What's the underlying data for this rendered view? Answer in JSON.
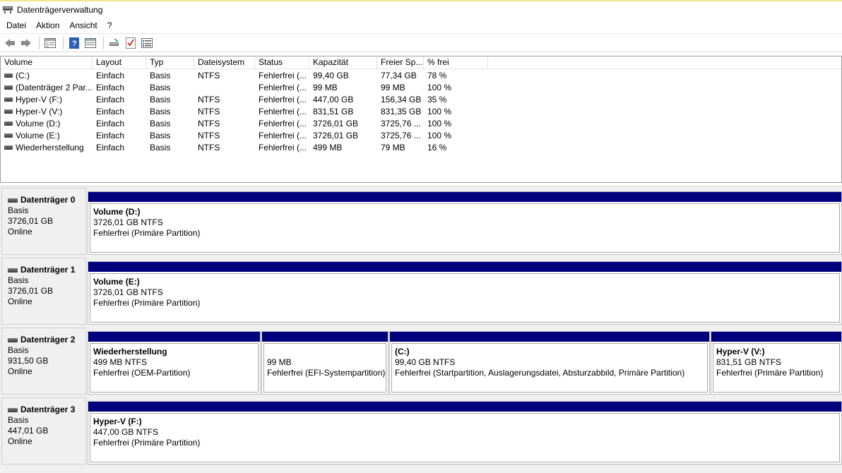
{
  "window": {
    "title": "Datenträgerverwaltung"
  },
  "menu": [
    "Datei",
    "Aktion",
    "Ansicht",
    "?"
  ],
  "toolbar": {
    "icons": [
      "back-icon",
      "forward-icon",
      "console-tree-icon",
      "help-icon",
      "properties-icon",
      "connect-disk-icon",
      "check-icon",
      "list-view-icon"
    ]
  },
  "volume_list": {
    "columns": [
      "Volume",
      "Layout",
      "Typ",
      "Dateisystem",
      "Status",
      "Kapazität",
      "Freier Sp...",
      "% frei"
    ],
    "rows": [
      [
        "(C:)",
        "Einfach",
        "Basis",
        "NTFS",
        "Fehlerfrei (...",
        "99,40 GB",
        "77,34 GB",
        "78 %"
      ],
      [
        "(Datenträger 2 Par...",
        "Einfach",
        "Basis",
        "",
        "Fehlerfrei (...",
        "99 MB",
        "99 MB",
        "100 %"
      ],
      [
        "Hyper-V (F:)",
        "Einfach",
        "Basis",
        "NTFS",
        "Fehlerfrei (...",
        "447,00 GB",
        "156,34 GB",
        "35 %"
      ],
      [
        "Hyper-V (V:)",
        "Einfach",
        "Basis",
        "NTFS",
        "Fehlerfrei (...",
        "831,51 GB",
        "831,35 GB",
        "100 %"
      ],
      [
        "Volume (D:)",
        "Einfach",
        "Basis",
        "NTFS",
        "Fehlerfrei (...",
        "3726,01 GB",
        "3725,76 ...",
        "100 %"
      ],
      [
        "Volume (E:)",
        "Einfach",
        "Basis",
        "NTFS",
        "Fehlerfrei (...",
        "3726,01 GB",
        "3725,76 ...",
        "100 %"
      ],
      [
        "Wiederherstellung",
        "Einfach",
        "Basis",
        "NTFS",
        "Fehlerfrei (...",
        "499 MB",
        "79 MB",
        "16 %"
      ]
    ]
  },
  "disks": [
    {
      "name": "Datenträger 0",
      "type": "Basis",
      "size": "3726,01 GB",
      "state": "Online",
      "partitions": [
        {
          "name": "Volume  (D:)",
          "size": "3726,01 GB NTFS",
          "status": "Fehlerfrei (Primäre Partition)"
        }
      ]
    },
    {
      "name": "Datenträger 1",
      "type": "Basis",
      "size": "3726,01 GB",
      "state": "Online",
      "partitions": [
        {
          "name": "Volume  (E:)",
          "size": "3726,01 GB NTFS",
          "status": "Fehlerfrei (Primäre Partition)"
        }
      ]
    },
    {
      "name": "Datenträger 2",
      "type": "Basis",
      "size": "931,50 GB",
      "state": "Online",
      "partitions": [
        {
          "name": "Wiederherstellung",
          "size": "499 MB NTFS",
          "status": "Fehlerfrei (OEM-Partition)"
        },
        {
          "name": "",
          "size": "99 MB",
          "status": "Fehlerfrei (EFI-Systempartition)"
        },
        {
          "name": "(C:)",
          "size": "99,40 GB NTFS",
          "status": "Fehlerfrei (Startpartition, Auslagerungsdatei, Absturzabbild, Primäre Partition)"
        },
        {
          "name": "Hyper-V  (V:)",
          "size": "831,51 GB NTFS",
          "status": "Fehlerfrei (Primäre Partition)"
        }
      ]
    },
    {
      "name": "Datenträger 3",
      "type": "Basis",
      "size": "447,01 GB",
      "state": "Online",
      "partitions": [
        {
          "name": "Hyper-V  (F:)",
          "size": "447,00 GB NTFS",
          "status": "Fehlerfrei (Primäre Partition)"
        }
      ]
    }
  ],
  "colors": {
    "partition_bar": "#00007f",
    "disk_area": "#f0f0f0"
  }
}
